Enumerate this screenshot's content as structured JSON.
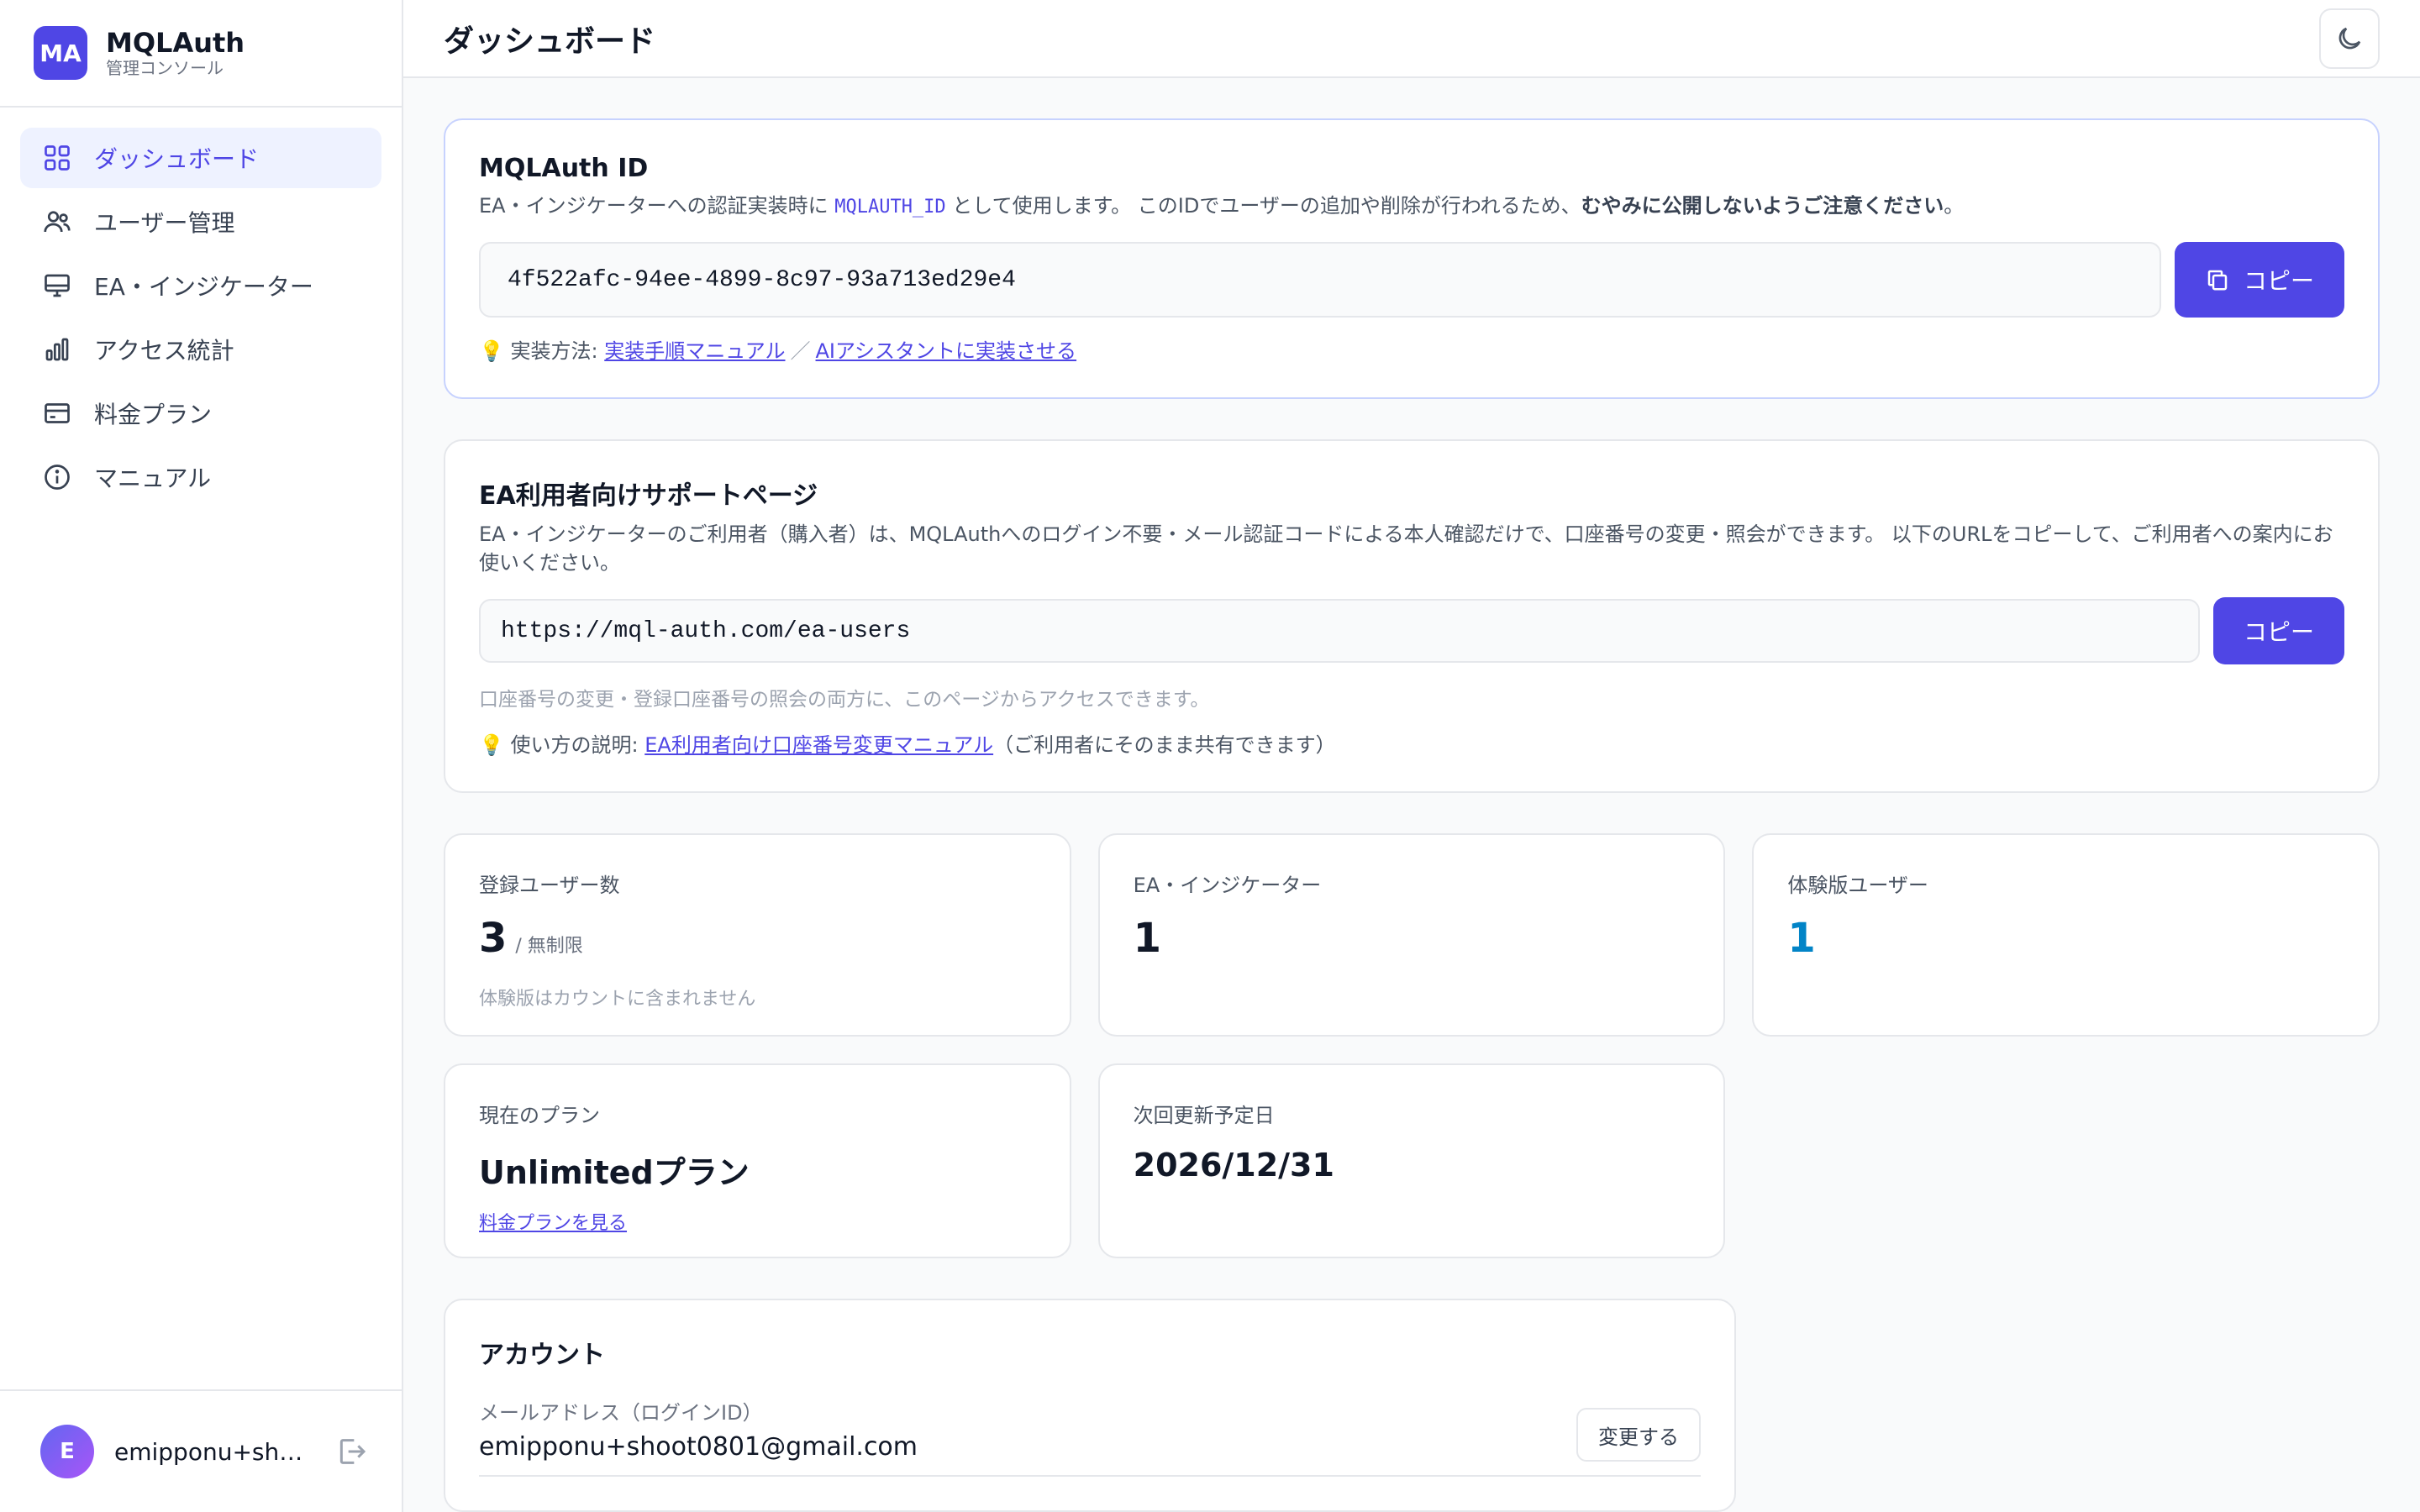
{
  "brand": {
    "logo": "MA",
    "name": "MQLAuth",
    "subtitle": "管理コンソール"
  },
  "nav": [
    {
      "label": "ダッシュボード",
      "icon": "grid-icon",
      "active": true
    },
    {
      "label": "ユーザー管理",
      "icon": "users-icon"
    },
    {
      "label": "EA・インジケーター",
      "icon": "monitor-icon"
    },
    {
      "label": "アクセス統計",
      "icon": "bar-chart-icon"
    },
    {
      "label": "料金プラン",
      "icon": "credit-card-icon"
    },
    {
      "label": "マニュアル",
      "icon": "info-icon"
    }
  ],
  "user": {
    "initial": "E",
    "name": "emipponu+sh…"
  },
  "header": {
    "title": "ダッシュボード"
  },
  "auth_id": {
    "title": "MQLAuth ID",
    "desc_pre": "EA・インジケーターへの認証実装時に ",
    "desc_code": "MQLAUTH_ID",
    "desc_mid": " として使用します。 このIDでユーザーの追加や削除が行われるため、",
    "desc_strong": "むやみに公開しないようご注意ください",
    "desc_post": "。",
    "value": "4f522afc-94ee-4899-8c97-93a713ed29e4",
    "copy_label": "コピー",
    "hint_prefix": "💡 実装方法: ",
    "link1": "実装手順マニュアル",
    "sep": "／",
    "link2": "AIアシスタントに実装させる"
  },
  "support": {
    "title": "EA利用者向けサポートページ",
    "desc": "EA・インジケーターのご利用者（購入者）は、MQLAuthへのログイン不要・メール認証コードによる本人確認だけで、口座番号の変更・照会ができます。 以下のURLをコピーして、ご利用者への案内にお使いください。",
    "url": "https://mql-auth.com/ea-users",
    "copy_label": "コピー",
    "note": "口座番号の変更・登録口座番号の照会の両方に、このページからアクセスできます。",
    "hint_prefix": "💡 使い方の説明: ",
    "link": "EA利用者向け口座番号変更マニュアル",
    "hint_suffix": "（ご利用者にそのまま共有できます）"
  },
  "stats": {
    "users": {
      "label": "登録ユーザー数",
      "value": "3",
      "unit": "/ 無制限",
      "note": "体験版はカウントに含まれません"
    },
    "ea": {
      "label": "EA・インジケーター",
      "value": "1"
    },
    "trial": {
      "label": "体験版ユーザー",
      "value": "1"
    },
    "plan": {
      "label": "現在のプラン",
      "value": "Unlimitedプラン",
      "link": "料金プランを見る"
    },
    "renewal": {
      "label": "次回更新予定日",
      "value": "2026/12/31"
    }
  },
  "account": {
    "title": "アカウント",
    "email_label": "メールアドレス（ログインID）",
    "email": "emipponu+shoot0801@gmail.com",
    "change_label": "変更する"
  },
  "colors": {
    "accent": "#4f46e5",
    "trial": "#0284c7"
  }
}
